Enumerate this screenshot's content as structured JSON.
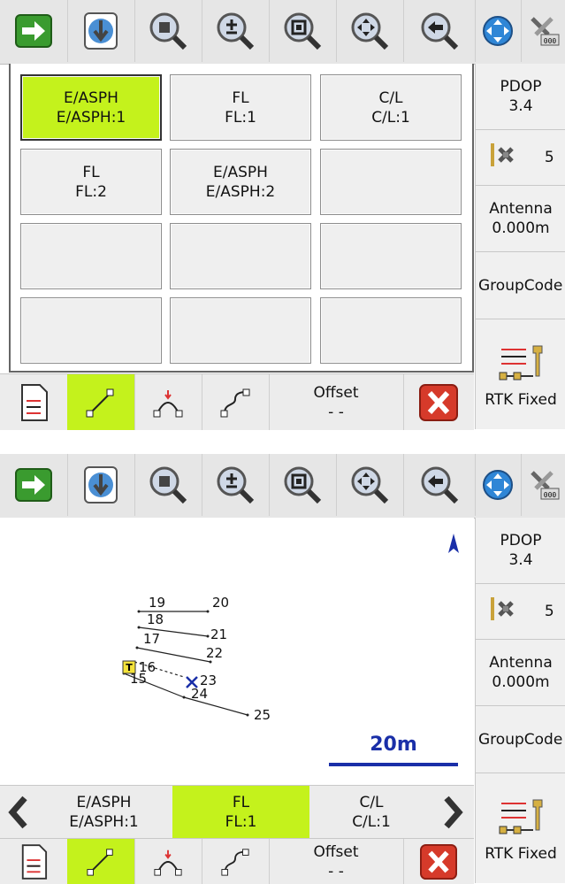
{
  "colors": {
    "accent": "#c4f21c",
    "toolbar": "#e6e6e6",
    "sidebar": "#f0f0f0",
    "scale_blue": "#1a2fa8"
  },
  "toolbar_icons": [
    "go-arrow-icon",
    "globe-download-icon",
    "zoom-center-icon",
    "zoom-in-out-icon",
    "zoom-window-icon",
    "zoom-pan-icon",
    "zoom-back-icon",
    "globe-pan-icon",
    "tools-icon"
  ],
  "top": {
    "status": {
      "pdop_label": "PDOP",
      "pdop_value": "3.4",
      "satellites": "5",
      "antenna_label": "Antenna",
      "antenna_value": "0.000m",
      "groupcode_label": "GroupCode",
      "rtk_label": "RTK Fixed"
    },
    "codes": [
      {
        "name": "E/ASPH",
        "sub": "E/ASPH:1",
        "active": true
      },
      {
        "name": "FL",
        "sub": "FL:1",
        "active": false
      },
      {
        "name": "C/L",
        "sub": "C/L:1",
        "active": false
      },
      {
        "name": "FL",
        "sub": "FL:2",
        "active": false
      },
      {
        "name": "E/ASPH",
        "sub": "E/ASPH:2",
        "active": false
      },
      {
        "name": "",
        "sub": "",
        "active": false
      },
      {
        "name": "",
        "sub": "",
        "active": false
      },
      {
        "name": "",
        "sub": "",
        "active": false
      },
      {
        "name": "",
        "sub": "",
        "active": false
      },
      {
        "name": "",
        "sub": "",
        "active": false
      },
      {
        "name": "",
        "sub": "",
        "active": false
      },
      {
        "name": "",
        "sub": "",
        "active": false
      }
    ],
    "bottom": {
      "offset_label": "Offset",
      "offset_value": "- -"
    }
  },
  "bottom": {
    "status": {
      "pdop_label": "PDOP",
      "pdop_value": "3.4",
      "satellites": "5",
      "antenna_label": "Antenna",
      "antenna_value": "0.000m",
      "groupcode_label": "GroupCode",
      "rtk_label": "RTK Fixed"
    },
    "map": {
      "points": [
        "19",
        "20",
        "18",
        "21",
        "17",
        "22",
        "16",
        "23",
        "15",
        "24",
        "25"
      ],
      "target_label": "T",
      "scale_label": "20m"
    },
    "code_tabs": [
      {
        "name": "E/ASPH",
        "sub": "E/ASPH:1"
      },
      {
        "name": "FL",
        "sub": "FL:1"
      },
      {
        "name": "C/L",
        "sub": "C/L:1"
      }
    ],
    "bottom": {
      "offset_label": "Offset",
      "offset_value": "- -"
    }
  }
}
